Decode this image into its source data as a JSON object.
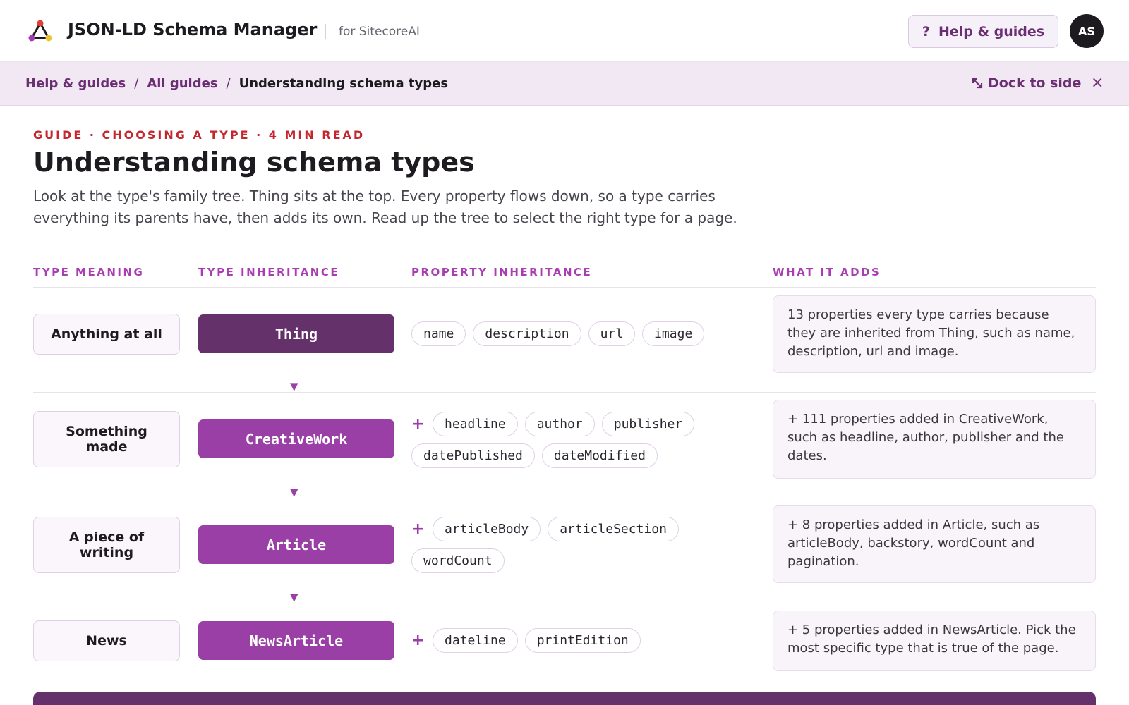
{
  "header": {
    "app_title": "JSON-LD Schema Manager",
    "app_subtitle": "for SitecoreAI",
    "help_button_label": "Help & guides",
    "help_icon": "?",
    "avatar_initials": "AS"
  },
  "breadcrumb": {
    "items": [
      "Help & guides",
      "All guides"
    ],
    "separator": "/",
    "current": "Understanding schema types",
    "dock_icon": "↙",
    "dock_label": "Dock to side",
    "close_icon": "×"
  },
  "article": {
    "kicker": "GUIDE · CHOOSING A TYPE · 4 MIN READ",
    "title": "Understanding schema types",
    "intro": "Look at the type's family tree. Thing sits at the top. Every property flows down, so a type carries everything its parents have, then adds its own. Read up the tree to select the right type for a page."
  },
  "columns": {
    "meaning": "TYPE MEANING",
    "inheritance": "TYPE INHERITANCE",
    "properties": "PROPERTY INHERITANCE",
    "adds": "WHAT IT ADDS"
  },
  "rows": [
    {
      "meaning": "Anything at all",
      "type": "Thing",
      "plus": "",
      "props": [
        "name",
        "description",
        "url",
        "image"
      ],
      "adds": "13 properties every type carries because they are inherited from Thing, such as name, description, url and image."
    },
    {
      "meaning": "Something made",
      "type": "CreativeWork",
      "plus": "+",
      "props": [
        "headline",
        "author",
        "publisher",
        "datePublished",
        "dateModified"
      ],
      "adds": "+ 111 properties added in CreativeWork, such as headline, author, publisher and the dates."
    },
    {
      "meaning": "A piece of writing",
      "type": "Article",
      "plus": "+",
      "props": [
        "articleBody",
        "articleSection",
        "wordCount"
      ],
      "adds": "+ 8 properties added in Article, such as articleBody, backstory, wordCount and pagination."
    },
    {
      "meaning": "News",
      "type": "NewsArticle",
      "plus": "+",
      "props": [
        "dateline",
        "printEdition"
      ],
      "adds": "+ 5 properties added in NewsArticle. Pick the most specific type that is true of the page."
    }
  ],
  "arrow_glyph": "▼",
  "colors": {
    "brand": "#6b2e73",
    "root_type": "#64316b",
    "sub_type": "#993fa6",
    "kicker": "#c4262e",
    "breadcrumb_bg": "#f2e8f3"
  }
}
